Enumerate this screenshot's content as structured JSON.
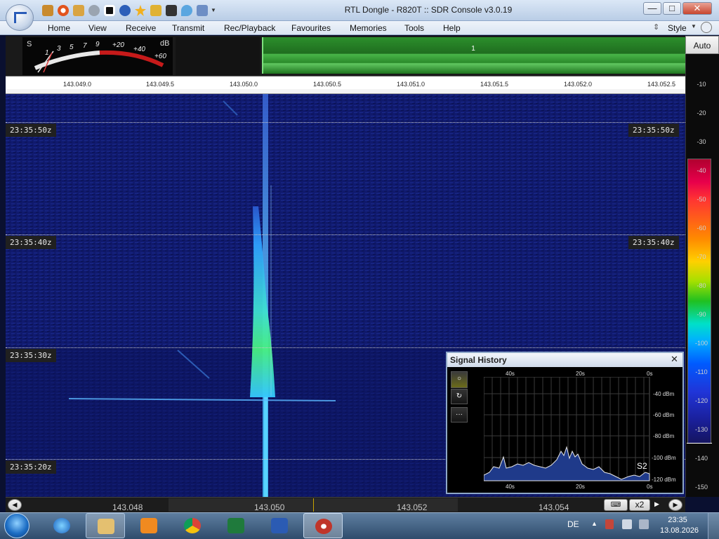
{
  "window": {
    "title": "RTL Dongle - R820T :: SDR Console v3.0.19",
    "controls": [
      "—",
      "□",
      "✕"
    ]
  },
  "menu": {
    "items": [
      "Home",
      "View",
      "Receive",
      "Transmit",
      "Rec/Playback",
      "Favourites",
      "Memories",
      "Tools",
      "Help"
    ],
    "style_label": "Style"
  },
  "smeter": {
    "s_label": "S",
    "db_label": "dB",
    "s_ticks": [
      "1",
      "3",
      "5",
      "7",
      "9"
    ],
    "plus_ticks": [
      "+20",
      "+40",
      "+60"
    ]
  },
  "spectrum": {
    "marker": "1"
  },
  "freq_ruler": {
    "labels": [
      "143.049.0",
      "143.049.5",
      "143.050.0",
      "143.050.5",
      "143.051.0",
      "143.051.5",
      "143.052.0",
      "143.052.5"
    ]
  },
  "waterfall": {
    "timestamps": [
      "23:35:50z",
      "23:35:40z",
      "23:35:30z",
      "23:35:20z"
    ]
  },
  "scale": {
    "auto_label": "Auto",
    "db_labels": [
      "-10",
      "-20",
      "-30",
      "-40",
      "-50",
      "-60",
      "-70",
      "-80",
      "-90",
      "-100",
      "-110",
      "-120",
      "-130",
      "-140",
      "-150"
    ]
  },
  "bottom_bar": {
    "freq_labels": [
      "143.048",
      "143.050",
      "143.052",
      "143.054"
    ],
    "zoom_label": "x2"
  },
  "signal_history": {
    "title": "Signal History",
    "close": "✕",
    "buttons": [
      "○",
      "↻",
      "···"
    ],
    "top_time_labels": [
      "40s",
      "20s",
      "0s"
    ],
    "bottom_time_labels": [
      "40s",
      "20s",
      "0s"
    ],
    "dbm_labels": [
      "-40 dBm",
      "-60 dBm",
      "-80 dBm",
      "-100 dBm",
      "-120 dBm"
    ],
    "s_reading": "S2"
  },
  "taskbar": {
    "language": "DE",
    "time": "23:35",
    "date": "13.08.2026"
  },
  "colors": {
    "waterfall_bg": "#0d1460",
    "signal": "#3fd7ff",
    "spectrum_green": "#2c8f2c"
  }
}
